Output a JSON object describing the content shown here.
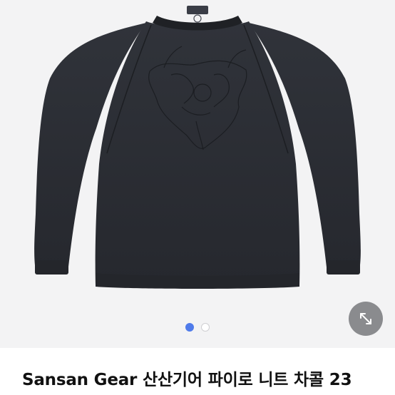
{
  "gallery": {
    "image_subject": "charcoal knit sweater with embroidered front graphic",
    "current_index": 1,
    "total_images": 2,
    "expand_icon": "expand-arrows-icon",
    "colors": {
      "background": "#f3f3f4",
      "sweater": "#2b2e34",
      "dot_active": "#4f7bea",
      "expand_button": "#8a8b8e"
    }
  },
  "product": {
    "title": "Sansan Gear 산산기어 파이로 니트 차콜 23"
  }
}
